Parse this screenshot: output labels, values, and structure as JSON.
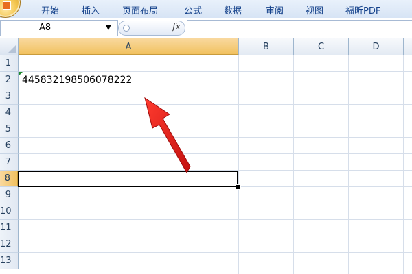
{
  "ribbon": {
    "tabs": [
      "开始",
      "插入",
      "页面布局",
      "公式",
      "数据",
      "审阅",
      "视图",
      "福昕PDF"
    ]
  },
  "formula_bar": {
    "name_box": "A8",
    "fx_label": "fx",
    "formula": ""
  },
  "sheet": {
    "columns": [
      "A",
      "B",
      "C",
      "D"
    ],
    "selected_column": "A",
    "rows": [
      "1",
      "2",
      "3",
      "4",
      "5",
      "6",
      "7",
      "8",
      "9",
      "10",
      "11",
      "12",
      "13"
    ],
    "selected_row": "8",
    "cells": {
      "A2": "445832198506078222"
    },
    "active_cell": "A8"
  },
  "annotation": {
    "arrow_color": "#e8191a"
  },
  "colors": {
    "selected_header": "#f1c15f",
    "ribbon_text": "#15428b",
    "error_indicator": "#1e8c2e"
  }
}
